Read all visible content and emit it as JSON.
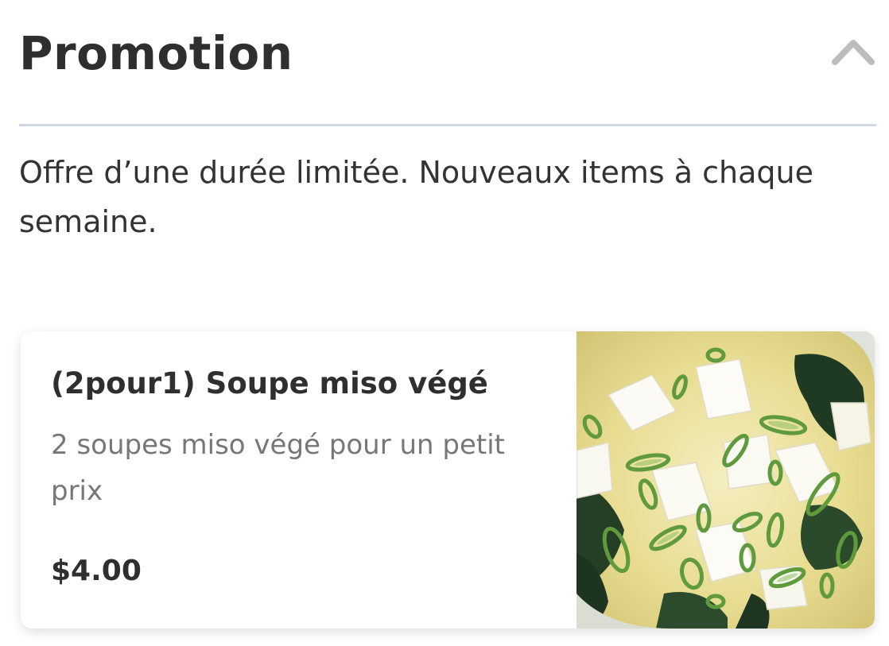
{
  "section": {
    "title": "Promotion",
    "description": "Offre d’une durée limitée. Nouveaux items à chaque semaine.",
    "collapse_icon": "chevron-up-icon",
    "divider_color": "#cfd6e4"
  },
  "items": [
    {
      "name": "(2pour1) Soupe miso végé",
      "description": "2 soupes miso végé pour un petit prix",
      "price": "$4.00",
      "image": "miso-soup-photo"
    }
  ]
}
